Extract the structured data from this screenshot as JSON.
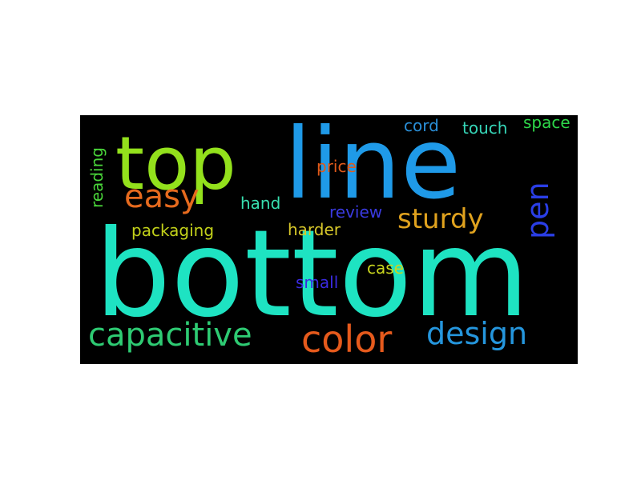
{
  "word_cloud": {
    "background_color": "#000000",
    "words": [
      {
        "text": "bottom",
        "color": "#1ee3c2",
        "orientation": "horizontal"
      },
      {
        "text": "line",
        "color": "#1f9ae8",
        "orientation": "horizontal"
      },
      {
        "text": "top",
        "color": "#93e11c",
        "orientation": "horizontal"
      },
      {
        "text": "capacitive",
        "color": "#2ecb73",
        "orientation": "horizontal"
      },
      {
        "text": "color",
        "color": "#e65a1c",
        "orientation": "horizontal"
      },
      {
        "text": "design",
        "color": "#2596dd",
        "orientation": "horizontal"
      },
      {
        "text": "easy",
        "color": "#e66a1e",
        "orientation": "horizontal"
      },
      {
        "text": "sturdy",
        "color": "#e0a21e",
        "orientation": "horizontal"
      },
      {
        "text": "pen",
        "color": "#2a3ee6",
        "orientation": "vertical"
      },
      {
        "text": "packaging",
        "color": "#c3d21a",
        "orientation": "horizontal"
      },
      {
        "text": "hand",
        "color": "#38e0b0",
        "orientation": "horizontal"
      },
      {
        "text": "harder",
        "color": "#d8c82a",
        "orientation": "horizontal"
      },
      {
        "text": "review",
        "color": "#3a3ae0",
        "orientation": "horizontal"
      },
      {
        "text": "price",
        "color": "#e05a1a",
        "orientation": "horizontal"
      },
      {
        "text": "cord",
        "color": "#2a8fd8",
        "orientation": "horizontal"
      },
      {
        "text": "touch",
        "color": "#36d6b8",
        "orientation": "horizontal"
      },
      {
        "text": "space",
        "color": "#2ed84a",
        "orientation": "horizontal"
      },
      {
        "text": "reading",
        "color": "#4ad63a",
        "orientation": "vertical"
      },
      {
        "text": "small",
        "color": "#3a2ae0",
        "orientation": "horizontal"
      },
      {
        "text": "case",
        "color": "#c9d61e",
        "orientation": "horizontal"
      }
    ]
  }
}
